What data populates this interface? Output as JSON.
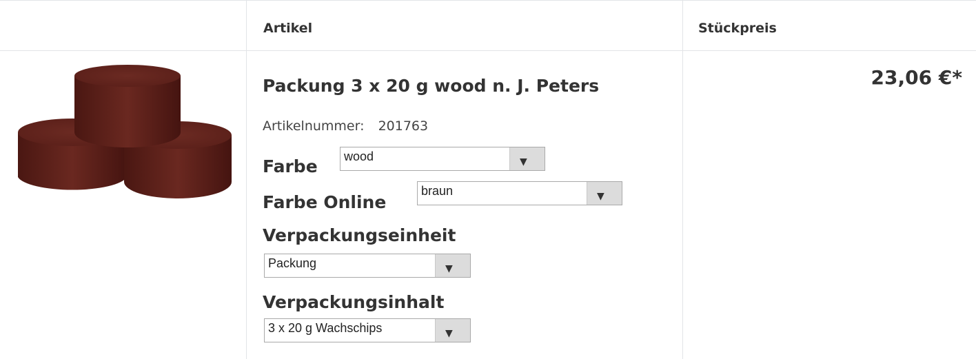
{
  "header": {
    "article_label": "Artikel",
    "price_label": "Stückpreis"
  },
  "product": {
    "image_alt": "wax chips",
    "title": "Packung 3 x 20 g wood n. J. Peters",
    "article_number_label": "Artikelnummer:",
    "article_number": "201763",
    "options": [
      {
        "label": "Farbe",
        "selected": "wood"
      },
      {
        "label": "Farbe Online",
        "selected": "braun"
      },
      {
        "label": "Verpackungseinheit",
        "selected": "Packung"
      },
      {
        "label": "Verpackungsinhalt",
        "selected": "3 x 20 g Wachschips"
      }
    ],
    "price": "23,06 €*"
  },
  "icons": {
    "dropdown": "triangle-down-icon"
  },
  "colors": {
    "wax": "#5b1f18",
    "border": "#e2e4e7"
  }
}
